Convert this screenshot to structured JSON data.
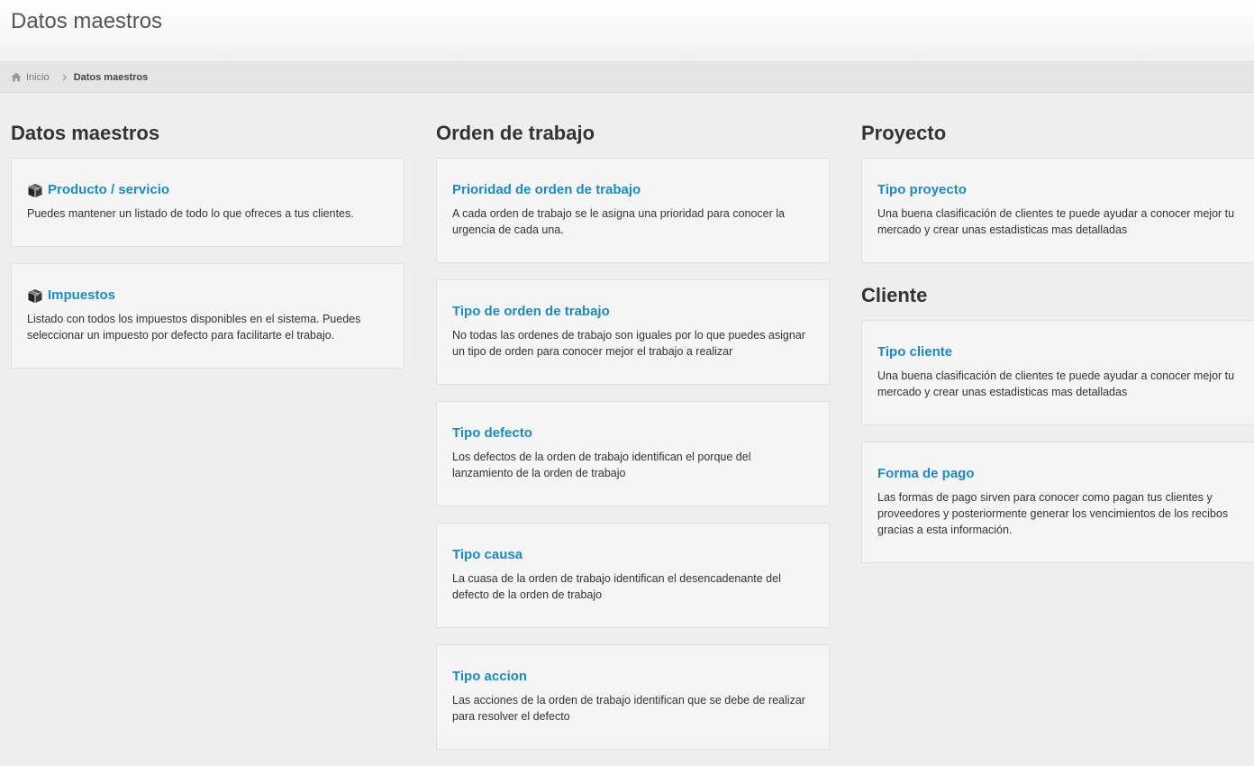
{
  "header": {
    "title": "Datos maestros"
  },
  "breadcrumb": {
    "home": "Inicio",
    "current": "Datos maestros"
  },
  "columns": [
    {
      "sections": [
        {
          "title": "Datos maestros",
          "cards": [
            {
              "title": "Producto / servicio",
              "icon": "box-icon",
              "desc": "Puedes mantener un listado de todo lo que ofreces a tus clientes."
            },
            {
              "title": "Impuestos",
              "icon": "box-icon",
              "desc": "Listado con todos los impuestos disponibles en el sistema. Puedes seleccionar un impuesto por defecto para facilitarte el trabajo."
            }
          ]
        }
      ]
    },
    {
      "sections": [
        {
          "title": "Orden de trabajo",
          "cards": [
            {
              "title": "Prioridad de orden de trabajo",
              "desc": "A cada orden de trabajo se le asigna una prioridad para conocer la urgencia de cada una."
            },
            {
              "title": "Tipo de orden de trabajo",
              "desc": "No todas las ordenes de trabajo son iguales por lo que puedes asignar un tipo de orden para conocer mejor el trabajo a realizar"
            },
            {
              "title": "Tipo defecto",
              "desc": "Los defectos de la orden de trabajo identifican el porque del lanzamiento de la orden de trabajo"
            },
            {
              "title": "Tipo causa",
              "desc": "La cuasa de la orden de trabajo identifican el desencadenante del defecto de la orden de trabajo"
            },
            {
              "title": "Tipo accion",
              "desc": "Las acciones de la orden de trabajo identifican que se debe de realizar para resolver el defecto"
            }
          ]
        }
      ]
    },
    {
      "sections": [
        {
          "title": "Proyecto",
          "cards": [
            {
              "title": "Tipo proyecto",
              "desc": "Una buena clasificación de clientes te puede ayudar a conocer mejor tu mercado y crear unas estadisticas mas detalladas"
            }
          ]
        },
        {
          "title": "Cliente",
          "cards": [
            {
              "title": "Tipo cliente",
              "desc": "Una buena clasificación de clientes te puede ayudar a conocer mejor tu mercado y crear unas estadisticas mas detalladas"
            },
            {
              "title": "Forma de pago",
              "desc": "Las formas de pago sirven para conocer como pagan tus clientes y proveedores y posteriormente generar los vencimientos de los recibos gracias a esta información."
            }
          ]
        }
      ]
    }
  ],
  "colors": {
    "link": "#1a8bc4",
    "text": "#333333",
    "background": "#eeeeee",
    "card": "#f5f5f5"
  }
}
